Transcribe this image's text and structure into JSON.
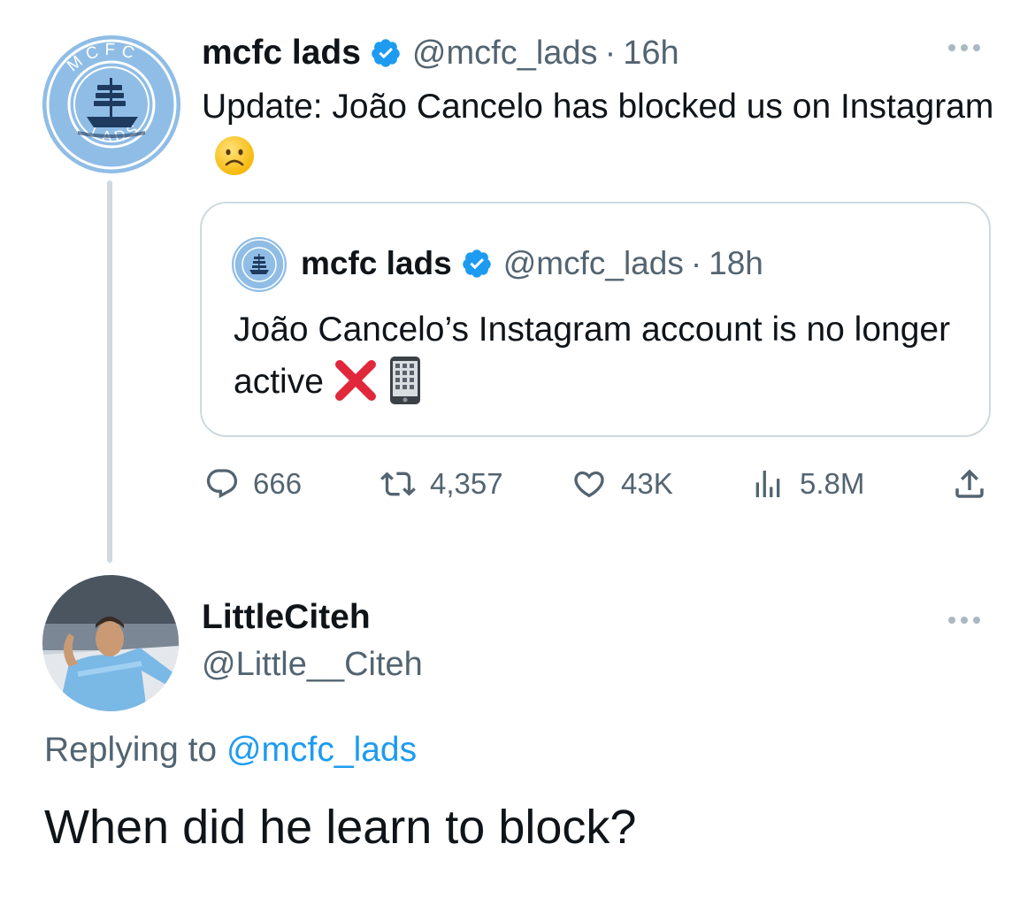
{
  "main_tweet": {
    "avatar_text_top": "MCFC",
    "avatar_text_bottom": "LADS",
    "display_name": "mcfc lads",
    "handle": "@mcfc_lads",
    "separator": "·",
    "time": "16h",
    "text": "Update: João Cancelo has blocked us on Instagram",
    "emoji": "sad-face"
  },
  "quoted_tweet": {
    "display_name": "mcfc lads",
    "handle": "@mcfc_lads",
    "separator": "·",
    "time": "18h",
    "text": "João Cancelo’s Instagram account is no longer active",
    "emojis": [
      "cross-mark",
      "mobile-phone"
    ]
  },
  "actions": {
    "replies": "666",
    "retweets": "4,357",
    "likes": "43K",
    "views": "5.8M"
  },
  "reply_tweet": {
    "display_name": "LittleCiteh",
    "handle": "@Little__Citeh",
    "replying_prefix": "Replying to",
    "replying_to": "@mcfc_lads",
    "text": "When did he learn to block?"
  },
  "colors": {
    "text": "#0f1419",
    "secondary": "#536471",
    "link": "#1d9bf0",
    "verified": "#1d9bf0",
    "border": "#cfd9de",
    "club_blue": "#8fbde6"
  }
}
